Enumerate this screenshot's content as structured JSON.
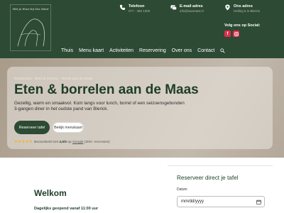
{
  "brand": {
    "tagline": "Wat je thuis bij Sax Maat"
  },
  "contact": {
    "phone": {
      "title": "Telefoon",
      "value": "077 - 480 1300"
    },
    "email": {
      "title": "E-mail adres",
      "value": "info@saxmaat.nl"
    },
    "address": {
      "title": "Ons adres",
      "value": "Helling 5 in Blerick"
    }
  },
  "social": {
    "title": "Volg ons op Social:",
    "items": [
      "facebook-icon",
      "instagram-icon"
    ]
  },
  "nav": {
    "items": [
      "Thuis",
      "Menu kaart",
      "Activiteiten",
      "Reservering",
      "Over ons",
      "Contact"
    ]
  },
  "hero": {
    "breadcrumb": "Restaurant · Blerick (Venlo) · Terras aan de Maas",
    "title": "Eten & borrelen aan de Maas",
    "body": "Gezellig, warm en smaakvol. Kom langs voor lunch, borrel of een seizoensgebonden 3-gangen diner in het oudste pand van Blerick.",
    "primary_button": "Reserveer tafel",
    "secondary_button": "Bekijk menukaart",
    "rating": {
      "stars": "★★★★★",
      "prefix": "Beoordeeld met",
      "score": "4,5/5",
      "via": "op",
      "source": "Google",
      "count": "(300+ recensies)"
    }
  },
  "welcome": {
    "title": "Welkom",
    "hours": "Dagelijks geopend vanaf 11:00 uur"
  },
  "reservation": {
    "title": "Reserveer direct je tafel",
    "date_label": "Datum",
    "date_placeholder": "mm/dd/yyyy"
  },
  "colors": {
    "brand_green": "#2c4a34",
    "accent_red": "#e02d4b",
    "star": "#f3b11b"
  }
}
